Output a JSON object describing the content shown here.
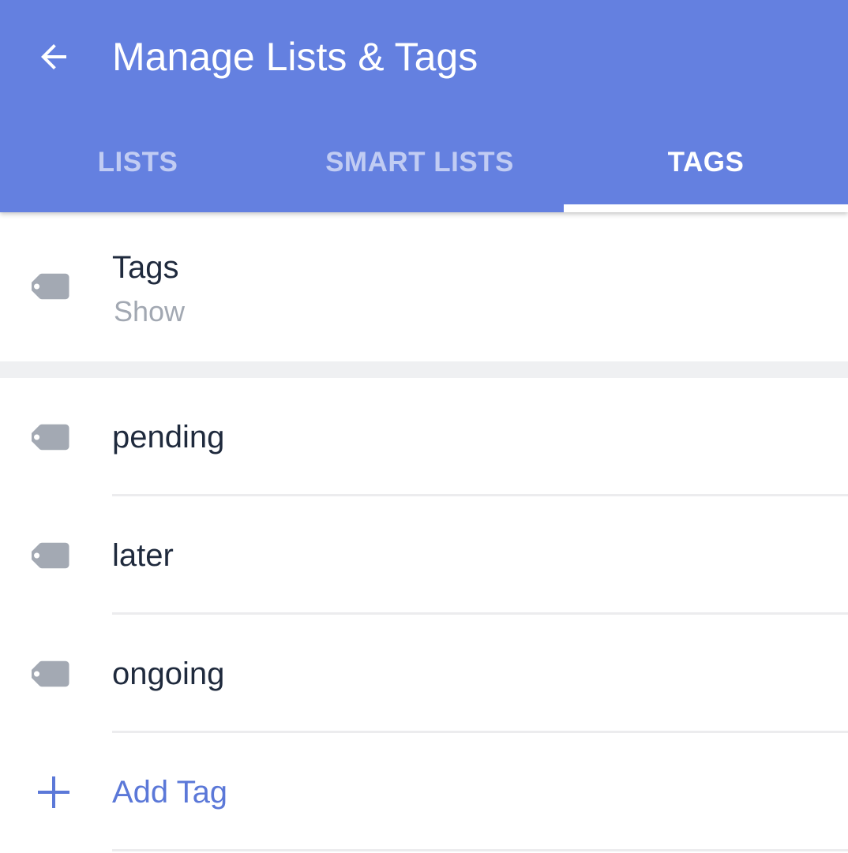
{
  "appbar": {
    "title": "Manage Lists & Tags",
    "color": "#6480e0"
  },
  "tabs": [
    {
      "label": "LISTS",
      "selected": false
    },
    {
      "label": "SMART LISTS",
      "selected": false
    },
    {
      "label": "TAGS",
      "selected": true
    }
  ],
  "header_row": {
    "title": "Tags",
    "subtitle": "Show",
    "icon": "tag-icon"
  },
  "tags": [
    {
      "label": "pending",
      "icon": "tag-icon"
    },
    {
      "label": "later",
      "icon": "tag-icon"
    },
    {
      "label": "ongoing",
      "icon": "tag-icon"
    }
  ],
  "add_row": {
    "label": "Add Tag",
    "icon": "plus-icon",
    "color": "#5b78d8"
  },
  "colors": {
    "icon_gray": "#a3a9b3",
    "text_dark": "#1f2a3d",
    "subtext": "#a2a8b2",
    "section_gap": "#eff0f2"
  }
}
